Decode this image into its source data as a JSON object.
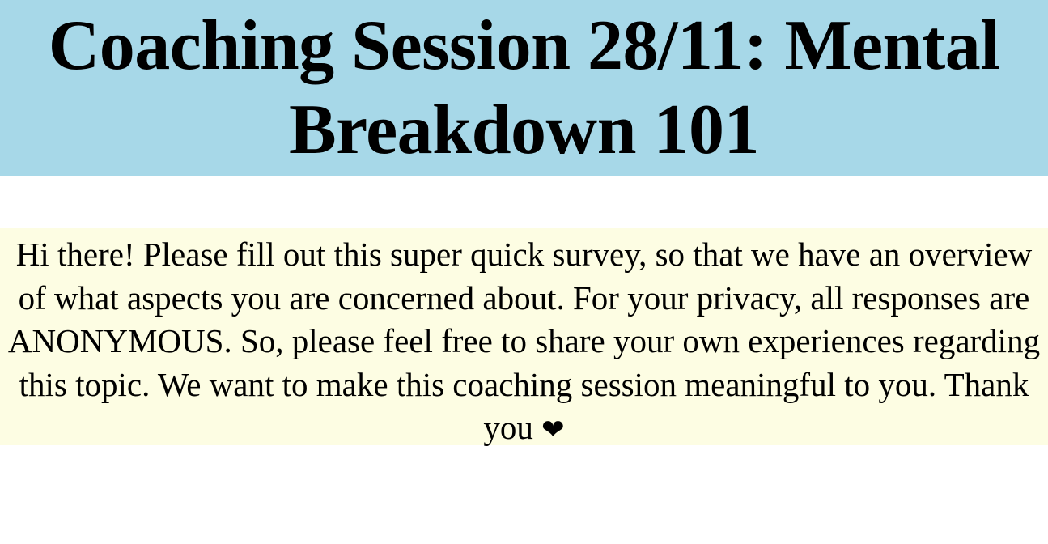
{
  "header": {
    "title_line1": "Coaching Session 28/11: Mental",
    "title_line2": "Breakdown 101",
    "background_color": "#a7d8e8"
  },
  "intro": {
    "text": "Hi there! Please fill out this super quick survey, so that we have an overview of what aspects you are concerned about. For your privacy, all responses are ANONYMOUS. So, please feel free to share your own experiences regarding this topic. We want to make this coaching session meaningful to you. Thank you",
    "heart_glyph": "❤",
    "icon": "heart-icon",
    "background_color": "#fdfde3"
  }
}
